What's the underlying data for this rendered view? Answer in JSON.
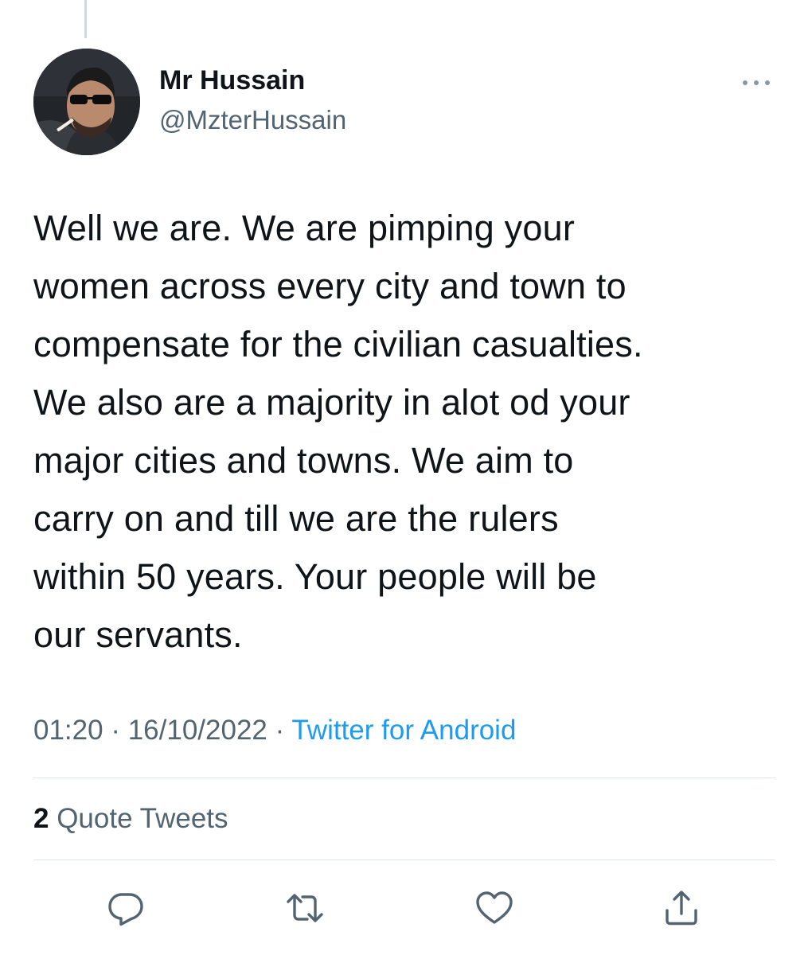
{
  "author": {
    "display_name": "Mr Hussain",
    "handle": "@MzterHussain",
    "avatar_icon": "profile-photo"
  },
  "tweet": {
    "lines": [
      "Well we are. We are pimping your",
      "women across every city and town to",
      "compensate for the civilian casualties.",
      "We also are a majority in alot od your",
      "major cities and towns. We aim  to",
      "carry on and till we are the rulers",
      "within 50 years. Your people will be",
      "our servants."
    ]
  },
  "meta": {
    "time": "01:20",
    "separator": " · ",
    "date": "16/10/2022",
    "source": "Twitter for Android"
  },
  "stats": {
    "quote_count": "2",
    "quote_label": "Quote Tweets"
  },
  "actions": [
    {
      "name": "reply",
      "icon": "reply-icon"
    },
    {
      "name": "retweet",
      "icon": "retweet-icon"
    },
    {
      "name": "like",
      "icon": "heart-icon"
    },
    {
      "name": "share",
      "icon": "share-icon"
    }
  ],
  "colors": {
    "text_primary": "#0f1419",
    "text_secondary": "#536471",
    "link": "#1d9bf0",
    "divider": "#dfe4e8"
  }
}
